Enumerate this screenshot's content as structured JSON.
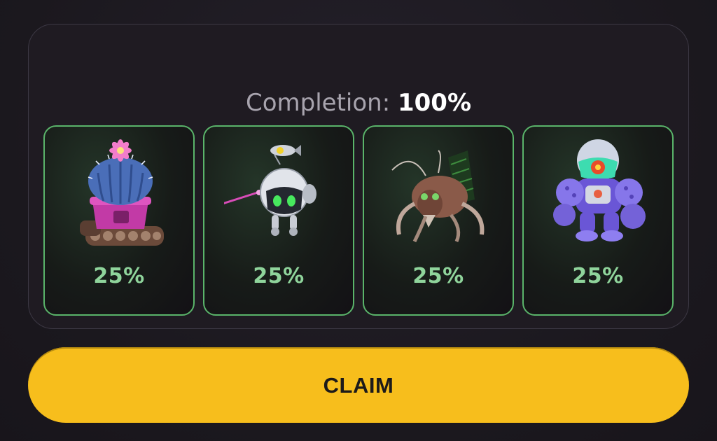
{
  "completion": {
    "label": "Completion:",
    "value": "100%",
    "fraction": 1.0
  },
  "cards": [
    {
      "name": "cactus-tank-robot-icon",
      "percent_label": "25%",
      "percent": 25
    },
    {
      "name": "floating-orb-robot-icon",
      "percent_label": "25%",
      "percent": 25
    },
    {
      "name": "mechanical-ant-icon",
      "percent_label": "25%",
      "percent": 25
    },
    {
      "name": "purple-diver-mech-icon",
      "percent_label": "25%",
      "percent": 25
    }
  ],
  "claim_button": {
    "label": "CLAIM",
    "color": "#f7be1c"
  },
  "colors": {
    "card_border": "#5ab46a",
    "percent_text": "#8fd49b"
  }
}
